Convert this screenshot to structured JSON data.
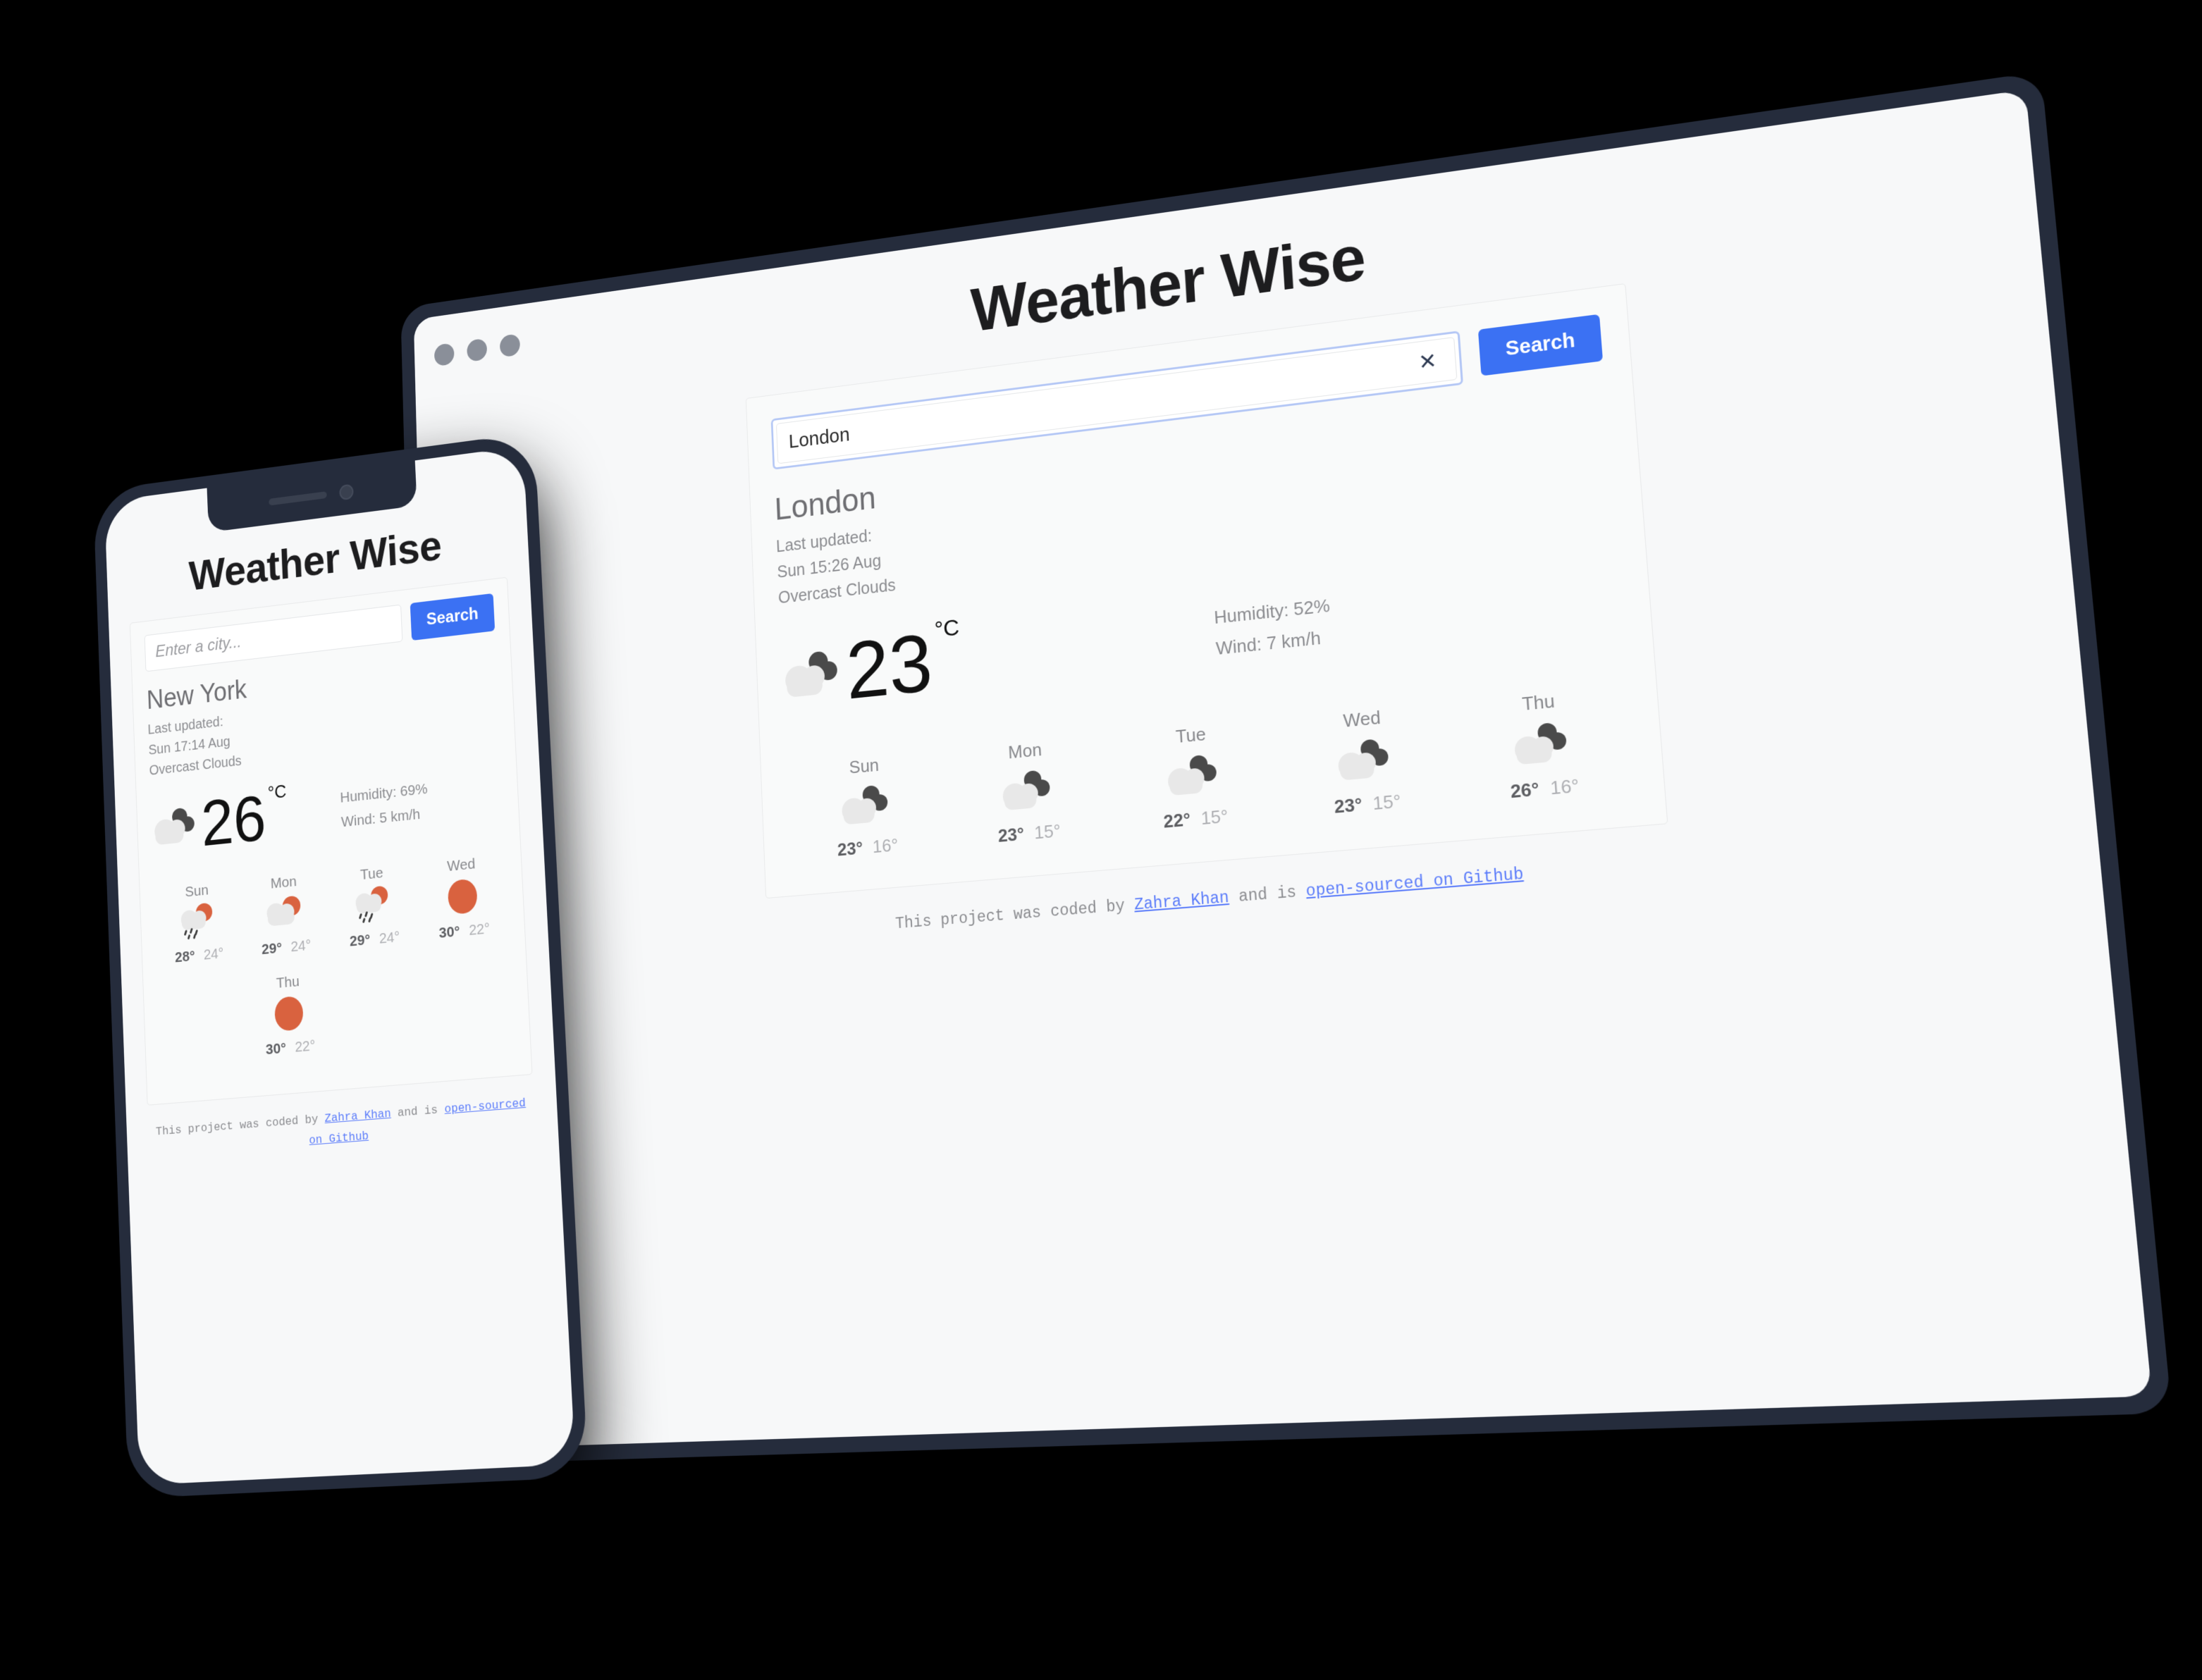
{
  "app": {
    "title": "Weather Wise"
  },
  "desktop": {
    "search": {
      "value": "London",
      "clear_icon": "close-icon",
      "button_label": "Search"
    },
    "current": {
      "city": "London",
      "last_updated_label": "Last updated:",
      "last_updated_value": "Sun 15:26 Aug",
      "condition": "Overcast Clouds",
      "temperature": "23",
      "unit": "°C",
      "icon": "overcast-clouds-icon",
      "humidity": "Humidity: 52%",
      "wind": "Wind: 7 km/h"
    },
    "forecast": [
      {
        "day": "Sun",
        "icon": "overcast-clouds-icon",
        "max": "23°",
        "min": "16°"
      },
      {
        "day": "Mon",
        "icon": "overcast-clouds-icon",
        "max": "23°",
        "min": "15°"
      },
      {
        "day": "Tue",
        "icon": "overcast-clouds-icon",
        "max": "22°",
        "min": "15°"
      },
      {
        "day": "Wed",
        "icon": "overcast-clouds-icon",
        "max": "23°",
        "min": "15°"
      },
      {
        "day": "Thu",
        "icon": "overcast-clouds-icon",
        "max": "26°",
        "min": "16°"
      }
    ],
    "footer": {
      "prefix": "This project was coded by ",
      "author_link": "Zahra Khan",
      "middle": " and is ",
      "source_link": "open-sourced on Github"
    }
  },
  "mobile": {
    "search": {
      "placeholder": "Enter a city...",
      "button_label": "Search"
    },
    "current": {
      "city": "New York",
      "last_updated_label": "Last updated:",
      "last_updated_value": "Sun 17:14 Aug",
      "condition": "Overcast Clouds",
      "temperature": "26",
      "unit": "°C",
      "icon": "overcast-clouds-icon",
      "humidity": "Humidity: 69%",
      "wind": "Wind: 5 km/h"
    },
    "forecast": [
      {
        "day": "Sun",
        "icon": "sun-rain-cloud-icon",
        "max": "28°",
        "min": "24°"
      },
      {
        "day": "Mon",
        "icon": "sun-cloud-icon",
        "max": "29°",
        "min": "24°"
      },
      {
        "day": "Tue",
        "icon": "sun-rain-cloud-icon",
        "max": "29°",
        "min": "24°"
      },
      {
        "day": "Wed",
        "icon": "sun-icon",
        "max": "30°",
        "min": "22°"
      },
      {
        "day": "Thu",
        "icon": "sun-icon",
        "max": "30°",
        "min": "22°"
      }
    ],
    "footer": {
      "prefix": "This project was coded by ",
      "author_link": "Zahra Khan",
      "middle": " and is ",
      "source_link": "open-sourced on Github"
    }
  },
  "theme": {
    "accent_blue": "#3b71f3",
    "link_blue": "#5b7cfa",
    "sun_orange": "#d9623f",
    "bezel": "#252c3c",
    "screen_bg": "#f7f8f9"
  }
}
